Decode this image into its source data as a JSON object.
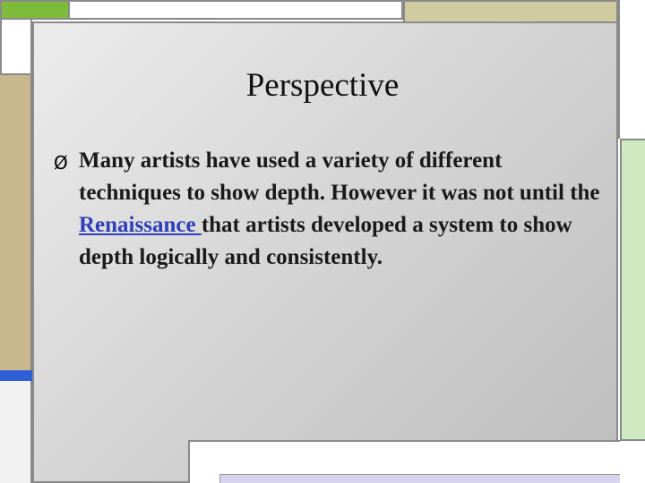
{
  "slide": {
    "title": "Perspective",
    "bullet": {
      "symbol": "Ø",
      "text_before": "Many artists have used a variety of different techniques to show depth. However it was not until the ",
      "link_text": "Renaissance ",
      "text_after": "that artists developed a system to show depth logically and consistently."
    }
  },
  "colors": {
    "green_block": "#7fbb3a",
    "khaki_block": "#d1cc9f",
    "tan_strip": "#c9b78e",
    "blue_strip": "#2d5fd6",
    "link": "#2e3fb8"
  }
}
